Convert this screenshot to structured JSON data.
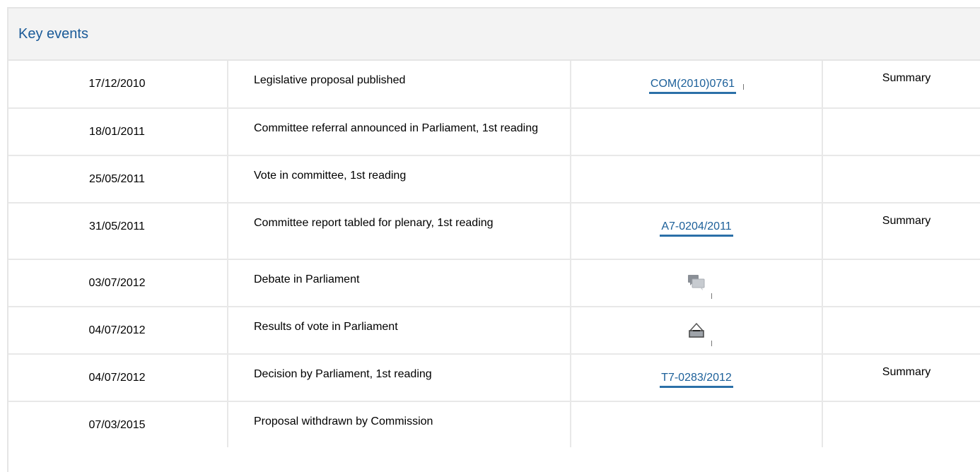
{
  "section_title": "Key events",
  "rows": [
    {
      "date": "17/12/2010",
      "event": "Legislative proposal published",
      "document": "COM(2010)0761",
      "summary": "Summary"
    },
    {
      "date": "18/01/2011",
      "event": "Committee referral announced in Parliament, 1st reading",
      "document": "",
      "summary": ""
    },
    {
      "date": "25/05/2011",
      "event": "Vote in committee, 1st reading",
      "document": "",
      "summary": ""
    },
    {
      "date": "31/05/2011",
      "event": "Committee report tabled for plenary, 1st reading",
      "document": "A7-0204/2011",
      "summary": "Summary"
    },
    {
      "date": "03/07/2012",
      "event": "Debate in Parliament",
      "document_icon": "debate-speech-bubbles-icon",
      "summary": ""
    },
    {
      "date": "04/07/2012",
      "event": "Results of vote in Parliament",
      "document_icon": "vote-ballot-box-icon",
      "summary": ""
    },
    {
      "date": "04/07/2012",
      "event": "Decision by Parliament, 1st reading",
      "document": "T7-0283/2012",
      "summary": "Summary"
    },
    {
      "date": "07/03/2015",
      "event": "Proposal withdrawn by Commission",
      "document": "",
      "summary": ""
    }
  ],
  "colors": {
    "title": "#1a5a98",
    "link": "#1b5f99",
    "link_underline": "#2b70a8",
    "header_bg": "#f3f3f3",
    "grid": "#e8e8e8"
  }
}
